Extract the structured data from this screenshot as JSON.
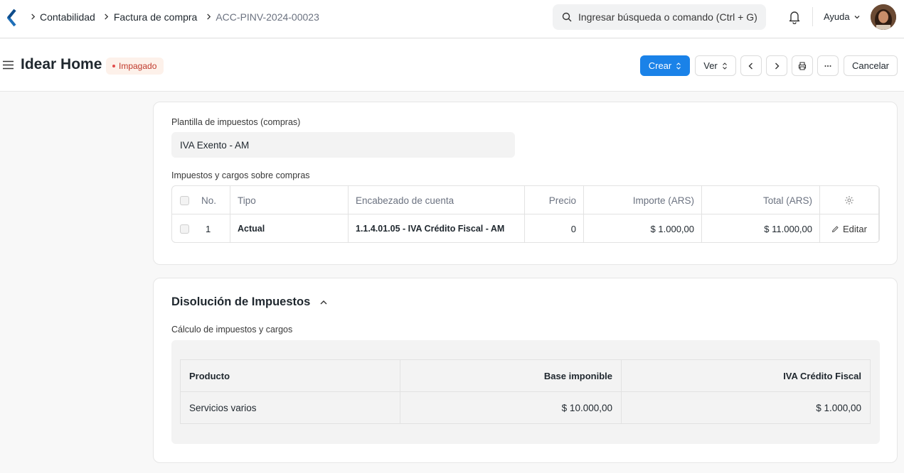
{
  "breadcrumbs": [
    "Contabilidad",
    "Factura de compra",
    "ACC-PINV-2024-00023"
  ],
  "search": {
    "placeholder": "Ingresar búsqueda o comando (Ctrl + G)"
  },
  "nav": {
    "help_label": "Ayuda"
  },
  "page": {
    "title": "Idear Home",
    "status": "Impagado",
    "status_color": "#e24c4c",
    "buttons": {
      "create": "Crear",
      "view": "Ver",
      "cancel": "Cancelar"
    }
  },
  "taxes_section": {
    "template_label": "Plantilla de impuestos (compras)",
    "template_value": "IVA Exento - AM",
    "table_label": "Impuestos y cargos sobre compras",
    "columns": [
      "No.",
      "Tipo",
      "Encabezado de cuenta",
      "Precio",
      "Importe (ARS)",
      "Total (ARS)"
    ],
    "rows": [
      {
        "no": "1",
        "tipo": "Actual",
        "cuenta": "1.1.4.01.05 - IVA Crédito Fiscal - AM",
        "precio": "0",
        "importe": "$ 1.000,00",
        "total": "$ 11.000,00",
        "edit_label": "Editar"
      }
    ]
  },
  "breakdown": {
    "title": "Disolución de Impuestos",
    "subtitle": "Cálculo de impuestos y cargos",
    "columns": [
      "Producto",
      "Base imponible",
      "IVA Crédito Fiscal"
    ],
    "rows": [
      {
        "producto": "Servicios varios",
        "base": "$ 10.000,00",
        "iva": "$ 1.000,00"
      }
    ]
  },
  "colors": {
    "primary": "#1a82e8",
    "accent_logo": "#1e6fb8"
  },
  "icons": [
    "app-logo-icon",
    "chevron-right-icon",
    "search-icon",
    "bell-icon",
    "chevron-down-icon",
    "hamburger-icon",
    "updown-icon",
    "chevron-left-icon",
    "printer-icon",
    "ellipsis-icon",
    "gear-icon",
    "pencil-icon",
    "chevron-up-icon"
  ]
}
